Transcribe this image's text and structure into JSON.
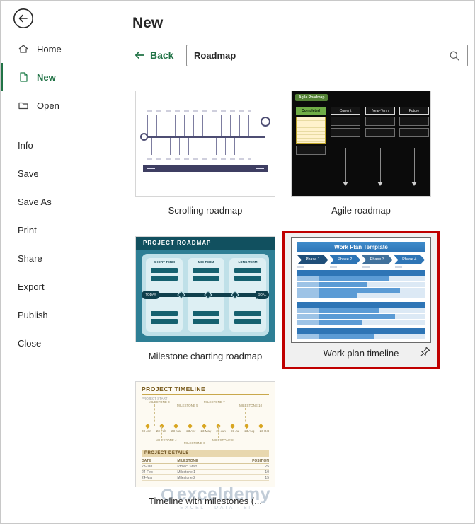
{
  "colors": {
    "accent": "#217346",
    "annotation-red": "#c00000",
    "selected-bg": "#f0f0f0"
  },
  "sidebar": {
    "items_top": [
      {
        "label": "Home"
      },
      {
        "label": "New"
      },
      {
        "label": "Open"
      }
    ],
    "items_menu": [
      {
        "label": "Info"
      },
      {
        "label": "Save"
      },
      {
        "label": "Save As"
      },
      {
        "label": "Print"
      },
      {
        "label": "Share"
      },
      {
        "label": "Export"
      },
      {
        "label": "Publish"
      },
      {
        "label": "Close"
      }
    ]
  },
  "main": {
    "title": "New",
    "back_label": "Back",
    "search_value": "Roadmap"
  },
  "templates": [
    {
      "label": "Scrolling roadmap"
    },
    {
      "label": "Agile roadmap"
    },
    {
      "label": "Milestone charting roadmap"
    },
    {
      "label": "Work plan timeline"
    },
    {
      "label": "Timeline with milestones (..."
    }
  ],
  "thumb_agile": {
    "title": "Agile Roadmap",
    "col_completed": "Completed",
    "col_current": "Current",
    "col_near": "Near-Term",
    "col_future": "Future"
  },
  "thumb_milestone": {
    "title": "PROJECT ROADMAP",
    "short": "SHORT TERM",
    "mid": "MID TERM",
    "long": "LONG TERM",
    "today": "TODAY",
    "goal": "GOAL"
  },
  "thumb_workplan": {
    "title": "Work Plan Template",
    "phases": [
      "Phase 1",
      "Phase 2",
      "Phase 3",
      "Phase 4"
    ]
  },
  "thumb_timeline": {
    "title": "PROJECT TIMELINE",
    "start": "PROJECT START",
    "details": "PROJECT DETAILS",
    "ms_above": [
      "MILESTONE 3",
      "MILESTONE 5",
      "MILESTONE 7",
      "MILESTONE 10"
    ],
    "ms_below": [
      "MILESTONE 4",
      "MILESTONE 6",
      "MILESTONE 8"
    ],
    "dates": [
      "23 Jan",
      "23 Feb",
      "23 Mar",
      "23 Apr",
      "23 May",
      "23 Jun",
      "23 Jul",
      "23 Aug",
      "23 Oct"
    ],
    "cols": [
      "DATE",
      "MILESTONE",
      "POSITION"
    ],
    "rows": [
      [
        "23-Jan",
        "Project Start",
        "25"
      ],
      [
        "24-Feb",
        "Milestone 1",
        "10"
      ],
      [
        "24-Mar",
        "Milestone 2",
        "15"
      ]
    ]
  },
  "watermark": {
    "brand": "exceldemy",
    "tagline": "EXCEL · DATA · BI"
  }
}
